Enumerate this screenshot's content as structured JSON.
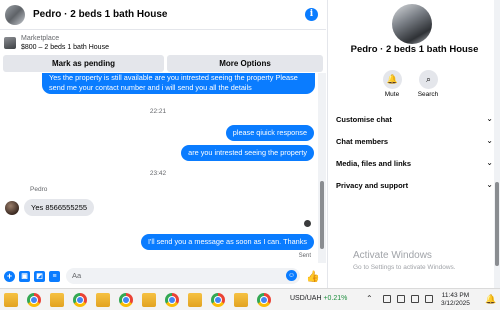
{
  "header": {
    "title": "Pedro · 2 beds 1 bath House",
    "info_icon": "info-icon"
  },
  "marketplace": {
    "label": "Marketplace",
    "price_line": "$800 – 2 beds 1 bath House"
  },
  "actions": {
    "mark_pending": "Mark as pending",
    "more_options": "More Options"
  },
  "messages": {
    "first_bubble": "Yes the property is still available are you intrested seeing the property Please send me your contact number and i will send you all the details",
    "time_1": "22:21",
    "outgoing_1": "please qiuick response",
    "outgoing_2": "are you intrested seeing the property",
    "time_2": "23:42",
    "sender_name": "Pedro",
    "incoming_1": "Yes 8566555255",
    "outgoing_3": "I'll send you a message as soon as I can. Thanks",
    "sent_label": "Sent"
  },
  "composer": {
    "placeholder": "Aa"
  },
  "sidebar": {
    "title": "Pedro · 2 beds 1 bath House",
    "mute_label": "Mute",
    "search_label": "Search",
    "sections": [
      {
        "label": "Customise chat"
      },
      {
        "label": "Chat members"
      },
      {
        "label": "Media, files and links"
      },
      {
        "label": "Privacy and support"
      }
    ]
  },
  "watermark": {
    "title": "Activate Windows",
    "subtitle": "Go to Settings to activate Windows."
  },
  "taskbar": {
    "ticker_name": "USD/UAH",
    "ticker_change": "+0.21%",
    "time": "11:43 PM",
    "date": "3/12/2025"
  },
  "colors": {
    "accent": "#0a7cff",
    "incoming_bubble": "#e4e6eb"
  }
}
